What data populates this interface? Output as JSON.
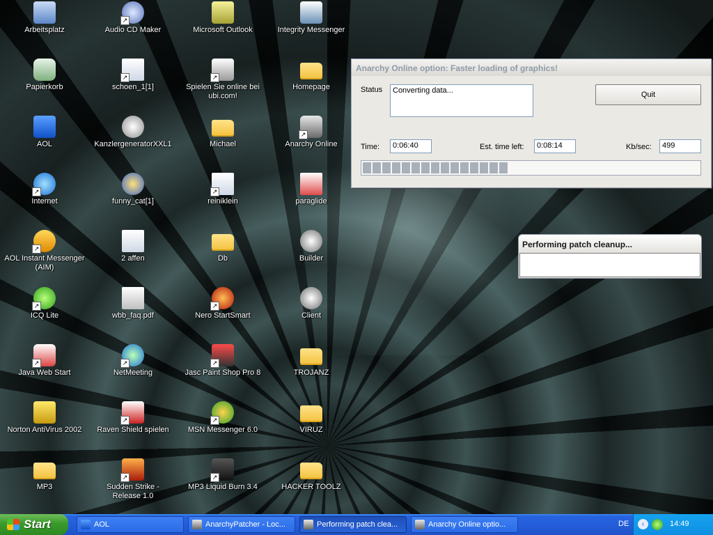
{
  "desktop_icons": [
    {
      "label": "Arbeitsplatz",
      "icon": "my-computer-icon"
    },
    {
      "label": "Papierkorb",
      "icon": "recycle-bin-icon"
    },
    {
      "label": "AOL",
      "icon": "aol-icon"
    },
    {
      "label": "Internet",
      "icon": "internet-explorer-icon"
    },
    {
      "label": "AOL Instant Messenger (AIM)",
      "icon": "aim-icon"
    },
    {
      "label": "ICQ Lite",
      "icon": "icq-icon"
    },
    {
      "label": "Java Web Start",
      "icon": "java-icon"
    },
    {
      "label": "Norton AntiVirus 2002",
      "icon": "norton-icon"
    },
    {
      "label": "MP3",
      "icon": "folder-icon"
    },
    {
      "label": "Audio CD Maker",
      "icon": "cd-icon"
    },
    {
      "label": "schoen_1[1]",
      "icon": "document-icon"
    },
    {
      "label": "KanzlergeneratorXXL1",
      "icon": "flash-icon"
    },
    {
      "label": "funny_cat[1]",
      "icon": "media-icon"
    },
    {
      "label": "2 affen",
      "icon": "document-icon"
    },
    {
      "label": "wbb_faq.pdf",
      "icon": "pdf-icon"
    },
    {
      "label": "NetMeeting",
      "icon": "netmeeting-icon"
    },
    {
      "label": "Raven Shield spielen",
      "icon": "raven-shield-icon"
    },
    {
      "label": "Sudden Strike - Release 1.0",
      "icon": "sudden-strike-icon"
    },
    {
      "label": "Microsoft Outlook",
      "icon": "outlook-icon"
    },
    {
      "label": "Spielen Sie online bei ubi.com!",
      "icon": "ubi-icon"
    },
    {
      "label": "Michael",
      "icon": "folder-icon"
    },
    {
      "label": "reiniklein",
      "icon": "document-icon"
    },
    {
      "label": "Db",
      "icon": "folder-icon"
    },
    {
      "label": "Nero StartSmart",
      "icon": "nero-icon"
    },
    {
      "label": "Jasc Paint Shop Pro 8",
      "icon": "paint-shop-pro-icon"
    },
    {
      "label": "MSN Messenger 6.0",
      "icon": "msn-icon"
    },
    {
      "label": "MP3 Liquid Burn 3.4",
      "icon": "liquid-burn-icon"
    },
    {
      "label": "Integrity Messenger",
      "icon": "messenger-icon"
    },
    {
      "label": "Homepage",
      "icon": "folder-icon"
    },
    {
      "label": "Anarchy Online",
      "icon": "anarchy-online-icon"
    },
    {
      "label": "paraglide",
      "icon": "paraglide-icon"
    },
    {
      "label": "Builder",
      "icon": "builder-icon"
    },
    {
      "label": "Client",
      "icon": "client-icon"
    },
    {
      "label": "TROJANZ",
      "icon": "folder-icon"
    },
    {
      "label": "VIRUZ",
      "icon": "folder-icon"
    },
    {
      "label": "HACKER TOOLZ",
      "icon": "folder-icon"
    }
  ],
  "patcher": {
    "title": "Anarchy Online option: Faster loading of graphics!",
    "status_label": "Status",
    "status_value": "Converting data...",
    "quit_label": "Quit",
    "time_label": "Time:",
    "time_value": "0:06:40",
    "est_label": "Est. time left:",
    "est_value": "0:08:14",
    "kb_label": "Kb/sec:",
    "kb_value": "499",
    "progress_fraction": 0.45
  },
  "cleanup": {
    "title": "Performing patch cleanup..."
  },
  "taskbar": {
    "start_label": "Start",
    "tasks": [
      {
        "label": "AOL",
        "icon": "aol-icon"
      },
      {
        "label": "AnarchyPatcher - Loc...",
        "icon": "anarchy-online-icon"
      },
      {
        "label": "Performing patch clea...",
        "icon": "anarchy-online-icon"
      },
      {
        "label": "Anarchy Online optio...",
        "icon": "anarchy-online-icon"
      }
    ],
    "language": "DE",
    "clock": "14:49"
  },
  "colors": {
    "taskbar_blue": "#245edb",
    "start_green": "#3a9a2b",
    "tray_blue": "#0f8fe2"
  }
}
